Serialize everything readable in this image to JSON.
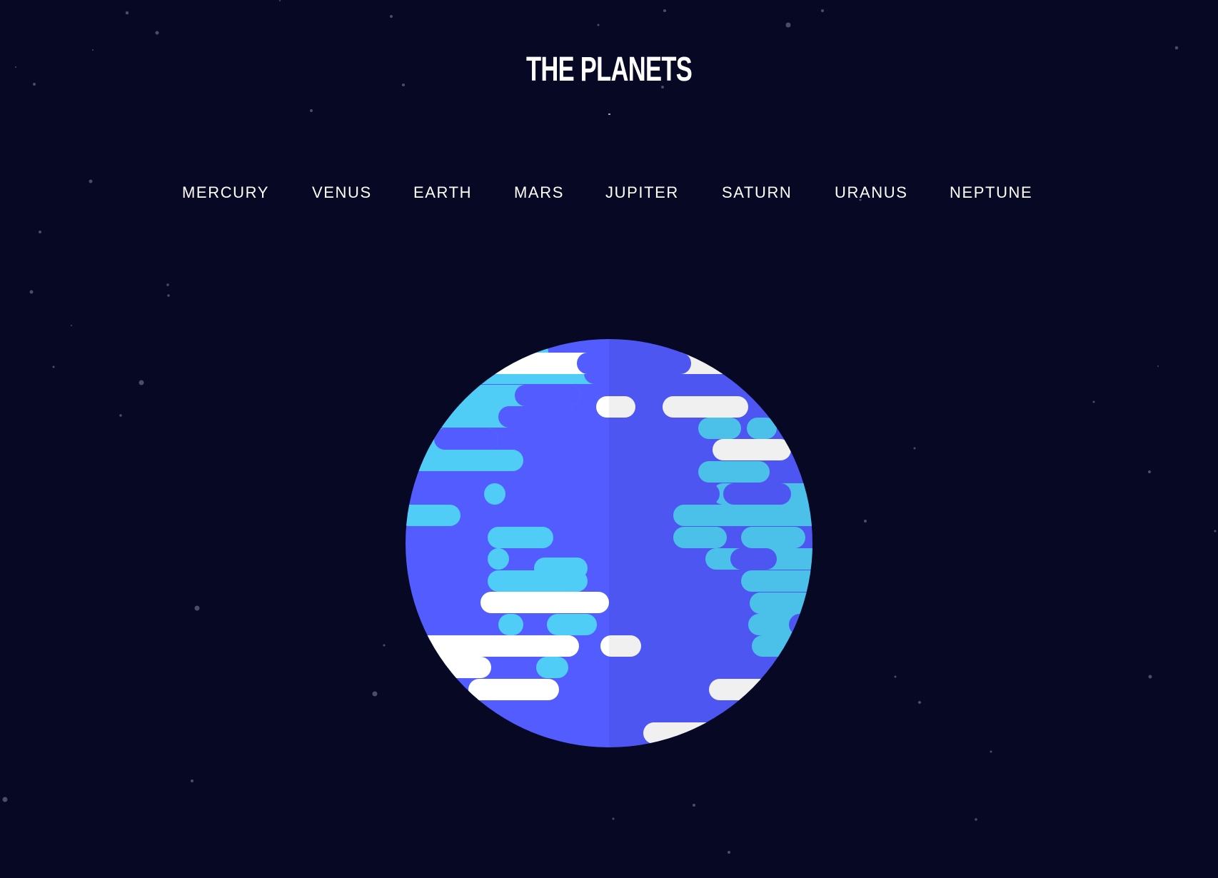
{
  "page": {
    "title": "THE PLANETS",
    "background": "#070823"
  },
  "nav": {
    "items": [
      {
        "label": "MERCURY"
      },
      {
        "label": "VENUS"
      },
      {
        "label": "EARTH"
      },
      {
        "label": "MARS"
      },
      {
        "label": "JUPITER"
      },
      {
        "label": "SATURN"
      },
      {
        "label": "URANUS"
      },
      {
        "label": "NEPTUNE"
      }
    ]
  },
  "planet": {
    "name": "EARTH",
    "colors": {
      "ocean": "#525cff",
      "ocean_shade": "#4e58ec",
      "land": "#50cdf7",
      "land_shade": "#48bde8",
      "cloud": "#ffffff",
      "cloud_shade": "#e8e8e8"
    }
  },
  "stars": {
    "color": "#4b4d66"
  }
}
